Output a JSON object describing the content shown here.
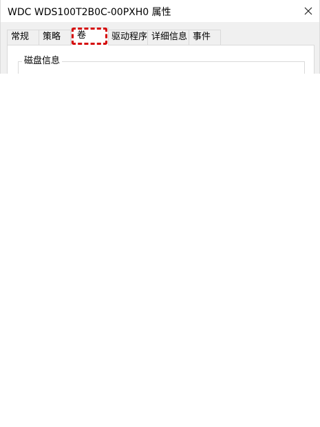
{
  "window": {
    "title": "WDC WDS100T2B0C-00PXH0 属性",
    "close_icon": "close-icon"
  },
  "tabs": [
    {
      "label": "常规",
      "selected": false
    },
    {
      "label": "策略",
      "selected": false
    },
    {
      "label": "卷",
      "selected": true
    },
    {
      "label": "驱动程序",
      "selected": false
    },
    {
      "label": "详细信息",
      "selected": false
    },
    {
      "label": "事件",
      "selected": false
    }
  ],
  "volume_tab": {
    "group_label": "磁盘信息"
  },
  "colors": {
    "highlight": "#d40000",
    "dialog_background": "#f0f0f0",
    "border": "#d9d9d9"
  }
}
